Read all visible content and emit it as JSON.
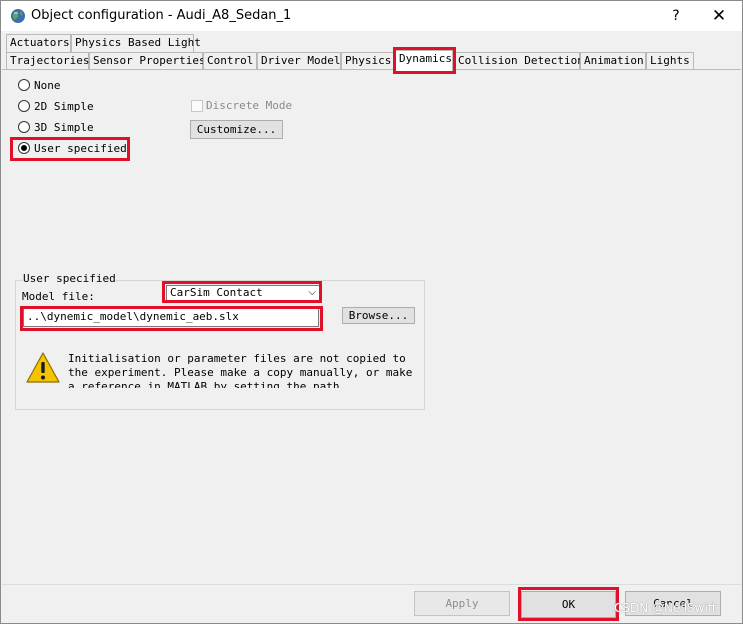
{
  "window": {
    "title": "Object configuration - Audi_A8_Sedan_1",
    "help_label": "?",
    "close_label": "✕"
  },
  "tabs_row1": [
    {
      "label": "Actuators"
    },
    {
      "label": "Physics Based Light"
    }
  ],
  "tabs_row2": [
    {
      "label": "Trajectories"
    },
    {
      "label": "Sensor Properties"
    },
    {
      "label": "Control"
    },
    {
      "label": "Driver Model"
    },
    {
      "label": "Physics"
    },
    {
      "label": "Dynamics",
      "active": true
    },
    {
      "label": "Collision Detection"
    },
    {
      "label": "Animation"
    },
    {
      "label": "Lights"
    }
  ],
  "dynamics": {
    "options": [
      {
        "label": "None",
        "checked": false
      },
      {
        "label": "2D Simple",
        "checked": false
      },
      {
        "label": "3D Simple",
        "checked": false
      },
      {
        "label": "User specified",
        "checked": true
      }
    ],
    "discrete_mode_label": "Discrete Mode",
    "customize_label": "Customize..."
  },
  "user_specified": {
    "group_title": "User specified",
    "model_file_label": "Model file:",
    "model_type_selected": "CarSim Contact",
    "model_file_value": "..\\dynemic_model\\dynemic_aeb.slx",
    "browse_label": "Browse...",
    "warning_text": "Initialisation or parameter files are not copied to the experiment. Please make a copy manually, or make a reference in MATLAB by setting the path"
  },
  "footer": {
    "apply_label": "Apply",
    "ok_label": "OK",
    "cancel_label": "Cancel"
  },
  "watermark": "CSDN @NeilSwift",
  "colors": {
    "highlight": "#e0102a",
    "window_bg": "#f0f0f0",
    "title_bg": "#ffffff"
  }
}
